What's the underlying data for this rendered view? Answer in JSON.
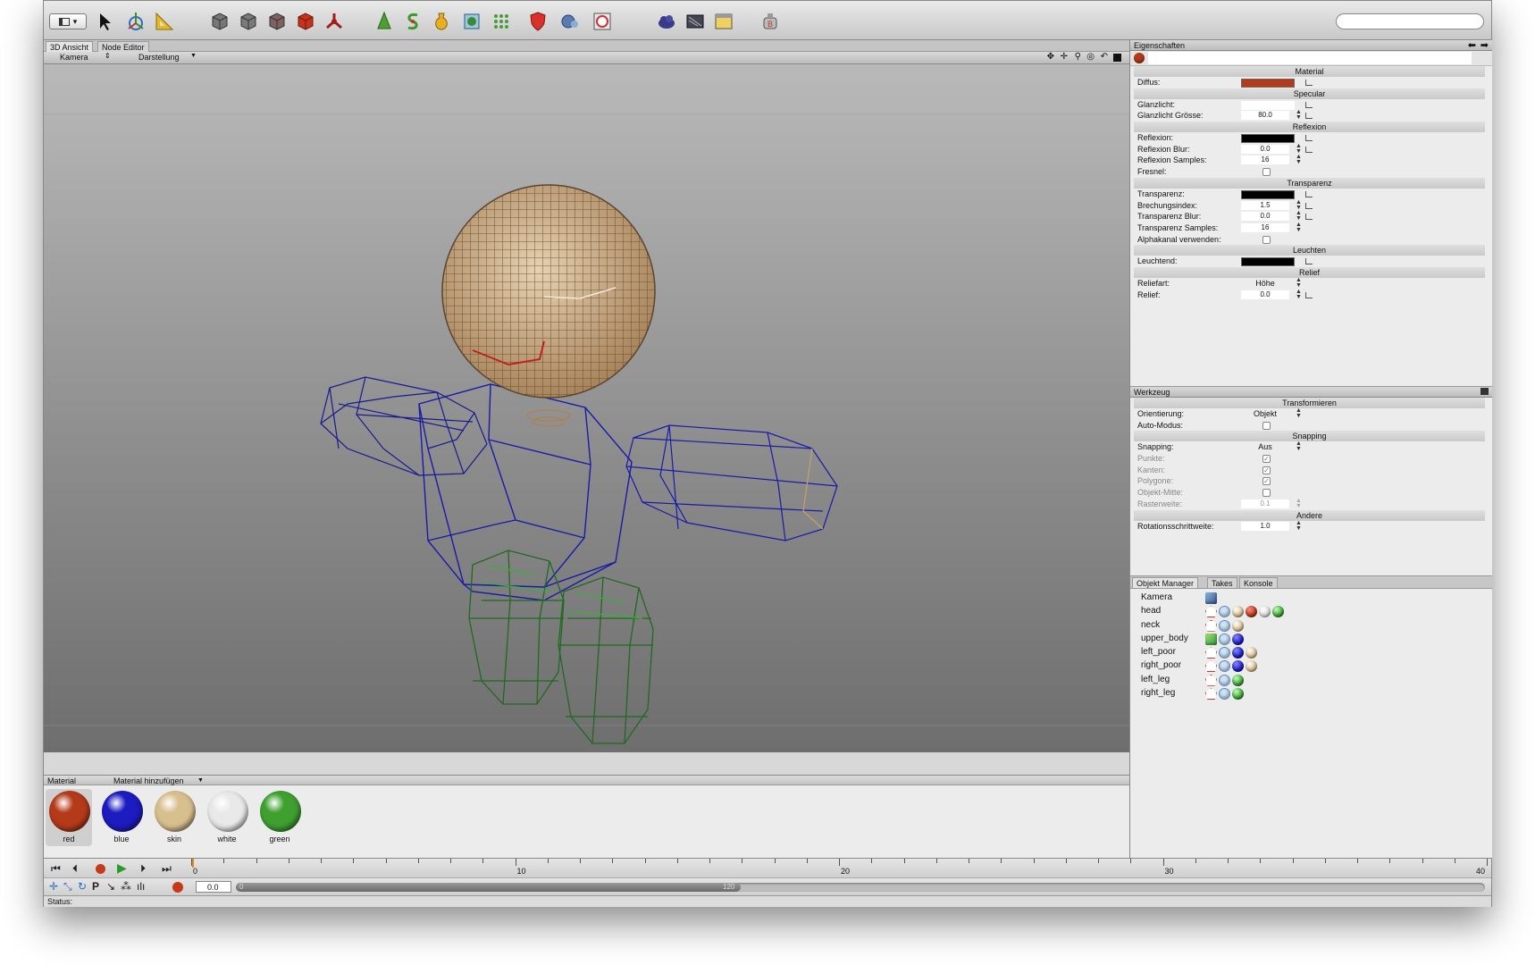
{
  "toolbar": {
    "view_toggle": "▾",
    "search_placeholder": "",
    "tools": [
      "select-arrow",
      "transform-tool",
      "measure-tool",
      "cube-gray",
      "cube-gray-2",
      "cube-gray-3",
      "cube-red",
      "emitter",
      "light-tree",
      "spline-s",
      "vase-object",
      "boolean-cube",
      "array-grid",
      "shield-deformer",
      "morph-object",
      "sphere-frame",
      "sky-cloud",
      "film-render",
      "render-window",
      "render-bake"
    ]
  },
  "tabs": {
    "view3d": "3D Ansicht",
    "node_editor": "Node Editor"
  },
  "viewmenu": {
    "kamera": "Kamera",
    "darstellung": "Darstellung"
  },
  "materials": {
    "header": "Material",
    "add": "Material hinzufügen",
    "items": [
      {
        "name": "red",
        "color": "#b53a1a"
      },
      {
        "name": "blue",
        "color": "#1c1cc0"
      },
      {
        "name": "skin",
        "color": "#d8bf8e"
      },
      {
        "name": "white",
        "color": "#e9e9e9"
      },
      {
        "name": "green",
        "color": "#3fa030"
      }
    ]
  },
  "props": {
    "title": "Eigenschaften",
    "sec_material": "Material",
    "diffus": "Diffus:",
    "sec_specular": "Specular",
    "glanzlicht": "Glanzlicht:",
    "glanz_groesse": "Glanzlicht Grösse:",
    "glanz_groesse_val": "80.0",
    "sec_reflexion": "Reflexion",
    "reflexion": "Reflexion:",
    "refl_blur": "Reflexion Blur:",
    "refl_blur_val": "0.0",
    "refl_samples": "Reflexion Samples:",
    "refl_samples_val": "16",
    "fresnel": "Fresnel:",
    "sec_transparenz": "Transparenz",
    "transparenz": "Transparenz:",
    "brechung": "Brechungsindex:",
    "brechung_val": "1.5",
    "trans_blur": "Transparenz Blur:",
    "trans_blur_val": "0.0",
    "trans_samples": "Transparenz Samples:",
    "trans_samples_val": "16",
    "alpha": "Alphakanal verwenden:",
    "sec_leuchten": "Leuchten",
    "leuchtend": "Leuchtend:",
    "sec_relief": "Relief",
    "reliefart": "Reliefart:",
    "reliefart_val": "Höhe",
    "relief": "Relief:",
    "relief_val": "0.0",
    "diffus_color": "#b53a1a"
  },
  "werkzeug": {
    "title": "Werkzeug",
    "sec_transform": "Transformieren",
    "orient": "Orientierung:",
    "orient_val": "Objekt",
    "auto": "Auto-Modus:",
    "sec_snap": "Snapping",
    "snapping": "Snapping:",
    "snapping_val": "Aus",
    "punkte": "Punkte:",
    "kanten": "Kanten:",
    "polygone": "Polygone:",
    "objmitte": "Objekt-Mitte:",
    "raster": "Rasterweite:",
    "raster_val": "0.1",
    "sec_andere": "Andere",
    "rotschritt": "Rotationsschrittweite:",
    "rotschritt_val": "1.0"
  },
  "objmgr": {
    "tabs": [
      "Objekt Manager",
      "Takes",
      "Konsole"
    ],
    "objects": [
      {
        "name": "Kamera",
        "tags": [
          "camera"
        ]
      },
      {
        "name": "head",
        "tags": [
          "phong",
          "uvw",
          "skin",
          "red",
          "white",
          "green"
        ]
      },
      {
        "name": "neck",
        "tags": [
          "phong",
          "uvw",
          "skin"
        ]
      },
      {
        "name": "upper_body",
        "tags": [
          "cube",
          "uvw",
          "blue"
        ]
      },
      {
        "name": "left_poor",
        "tags": [
          "phong",
          "uvw",
          "blue",
          "skin"
        ]
      },
      {
        "name": "right_poor",
        "tags": [
          "phong",
          "uvw",
          "blue",
          "skin"
        ]
      },
      {
        "name": "left_leg",
        "tags": [
          "phong",
          "uvw",
          "green"
        ]
      },
      {
        "name": "right_leg",
        "tags": [
          "phong",
          "uvw",
          "green"
        ]
      }
    ]
  },
  "timeline": {
    "ticks": [
      "0",
      "10",
      "20",
      "30",
      "40"
    ],
    "frame_value": "0.0",
    "slider_start": "0",
    "slider_end": "120",
    "status": "Status:"
  }
}
